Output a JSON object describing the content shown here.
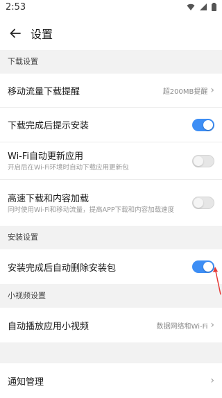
{
  "status": {
    "time": "2:53"
  },
  "header": {
    "title": "设置"
  },
  "sections": [
    {
      "header": "下载设置",
      "rows": [
        {
          "label": "移动流量下载提醒",
          "value": "超200MB提醒",
          "type": "link"
        },
        {
          "label": "下载完成后提示安装",
          "type": "toggle",
          "on": true
        },
        {
          "label": "Wi-Fi自动更新应用",
          "sub": "开启后在Wi-Fi环境时自动下载应用更新包",
          "type": "toggle",
          "on": false
        },
        {
          "label": "高速下载和内容加载",
          "sub": "同时使用Wi-Fi和移动流量，提高APP下载和内容加载速度",
          "type": "toggle",
          "on": false
        }
      ]
    },
    {
      "header": "安装设置",
      "rows": [
        {
          "label": "安装完成后自动删除安装包",
          "type": "toggle",
          "on": true
        }
      ]
    },
    {
      "header": "小视频设置",
      "rows": [
        {
          "label": "自动播放应用小视频",
          "value": "数据网络和Wi-Fi",
          "type": "link"
        }
      ]
    },
    {
      "header": "",
      "rows": [
        {
          "label": "通知管理",
          "type": "link"
        }
      ]
    }
  ],
  "colors": {
    "toggle_on": "#3d8ef5",
    "annotation_arrow": "#e53935"
  }
}
